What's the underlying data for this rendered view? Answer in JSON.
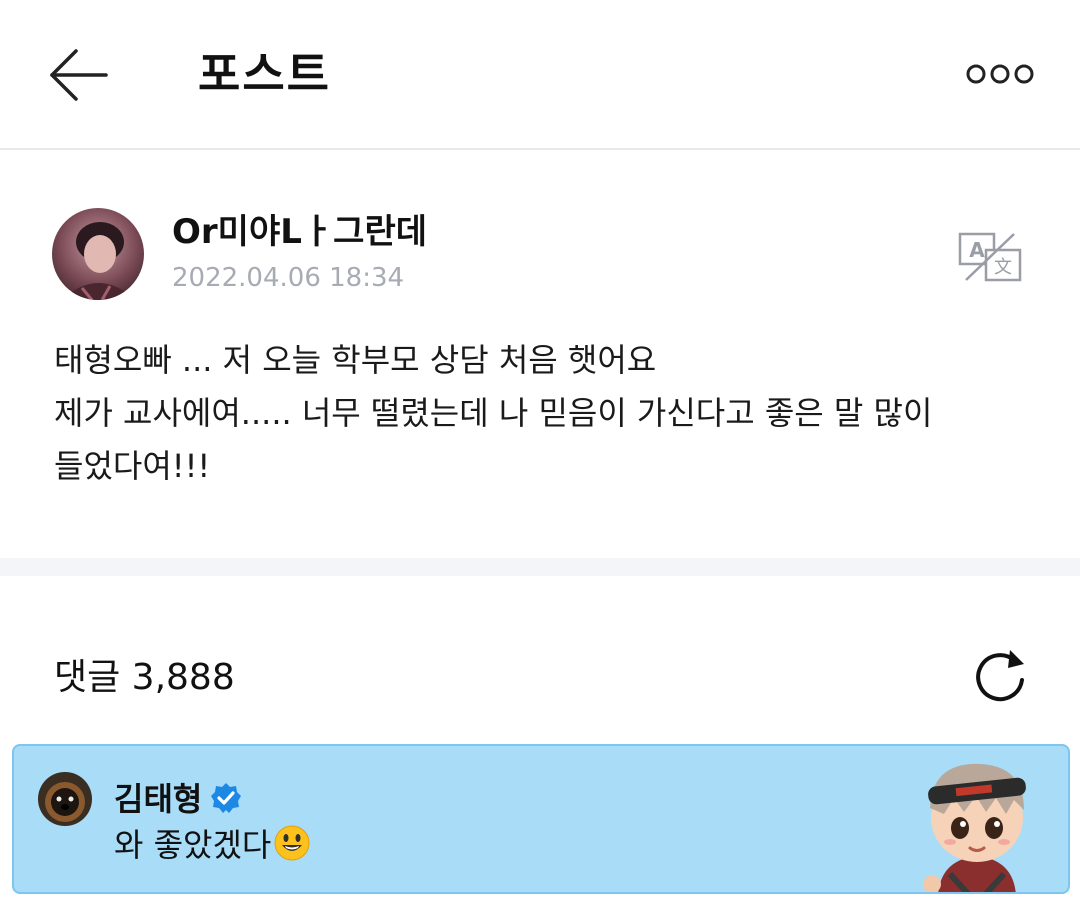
{
  "header": {
    "title": "포스트",
    "back_icon": "arrow-left-icon",
    "more_icon": "more-dots-icon"
  },
  "post": {
    "author": "Or미야Lㅏ그란데",
    "date": "2022.04.06 18:34",
    "translate_icon": "translate-icon",
    "body_lines": [
      "태형오빠 ... 저 오늘 학부모 상담 처음 햇어요",
      "제가 교사에여..... 너무 떨렸는데 나 믿음이 가신다고 좋은 말 많이",
      "들었다여!!!"
    ]
  },
  "comments": {
    "label": "댓글 3,888",
    "refresh_icon": "refresh-icon"
  },
  "highlighted_comment": {
    "name": "김태형",
    "verified_icon": "verified-badge-icon",
    "text": "와 좋았겠다",
    "emoji": "smiley-emoji-icon",
    "background": "#a8dcf7",
    "border": "#7cc6ef"
  },
  "colors": {
    "divider": "#f4f5f9",
    "date_gray": "#a8abb3",
    "verified_blue": "#1e88e5"
  }
}
